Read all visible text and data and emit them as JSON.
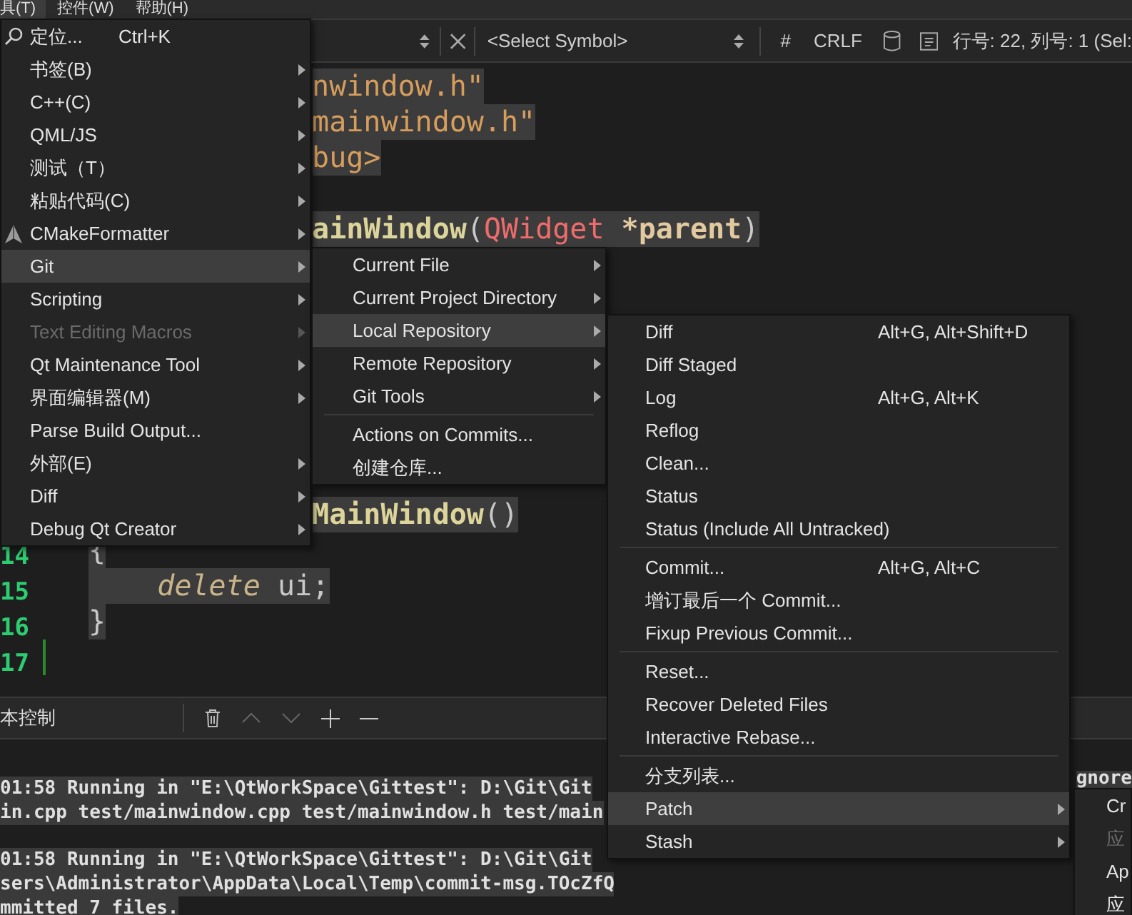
{
  "menubar": [
    {
      "label": "具(T)",
      "selected": true
    },
    {
      "label": "控件(W)",
      "selected": false
    },
    {
      "label": "帮助(H)",
      "selected": false
    }
  ],
  "editor_toolbar": {
    "symbol_placeholder": "<Select Symbol>",
    "indent": "#",
    "line_ending": "CRLF",
    "position": "行号: 22, 列号: 1 (Sel:"
  },
  "code_lines": [
    {
      "covered_by_menu": true,
      "selected": true,
      "segments": [
        {
          "kind": "string",
          "text": "nwindow.h\""
        }
      ]
    },
    {
      "covered_by_menu": true,
      "selected": true,
      "segments": [
        {
          "kind": "string",
          "text": "mainwindow.h\""
        }
      ]
    },
    {
      "covered_by_menu": true,
      "selected": true,
      "segments": [
        {
          "kind": "string",
          "text": "bug>"
        }
      ]
    },
    {
      "blank": true
    },
    {
      "covered_by_menu": true,
      "selected": true,
      "segments": [
        {
          "kind": "function",
          "text": "ainWindow"
        },
        {
          "kind": "plain",
          "text": "("
        },
        {
          "kind": "type",
          "text": "QWidget"
        },
        {
          "kind": "param",
          "text": " *parent"
        },
        {
          "kind": "plain",
          "text": ")"
        }
      ]
    },
    {
      "blank": true
    },
    {
      "blank": true
    },
    {
      "blank": true
    },
    {
      "blank": true
    },
    {
      "blank": true
    },
    {
      "blank": true
    },
    {
      "blank": true
    },
    {
      "covered_by_menu": true,
      "selected": true,
      "segments": [
        {
          "kind": "function",
          "text": "MainWindow"
        },
        {
          "kind": "plain",
          "text": "()"
        }
      ]
    },
    {
      "number": "14",
      "covered_by_menu": false,
      "selected": true,
      "segments": [
        {
          "kind": "plain",
          "text": "{"
        }
      ]
    },
    {
      "number": "15",
      "covered_by_menu": false,
      "selected": true,
      "segments": [
        {
          "kind": "keyword",
          "text": "    delete"
        },
        {
          "kind": "plain",
          "text": " ui;"
        }
      ]
    },
    {
      "number": "16",
      "covered_by_menu": false,
      "selected": true,
      "segments": [
        {
          "kind": "plain",
          "text": "}"
        }
      ]
    },
    {
      "number": "17",
      "blank": true
    }
  ],
  "output_panel": {
    "title": "本控制",
    "entries": [
      {
        "lines": [
          "01:58 Running in \"E:\\QtWorkSpace\\Gittest\": D:\\Git\\Git",
          "in.cpp test/mainwindow.cpp test/mainwindow.h test/main"
        ],
        "tail": "gnore"
      },
      {
        "lines": [
          "01:58 Running in \"E:\\QtWorkSpace\\Gittest\": D:\\Git\\Git",
          "sers\\Administrator\\AppData\\Local\\Temp\\commit-msg.TOcZfQ",
          "mmitted 7 files."
        ]
      }
    ]
  },
  "tools_menu": {
    "items": [
      {
        "kind": "icon_item",
        "label": "定位...",
        "shortcut": "Ctrl+K",
        "submenu": false,
        "selected": false,
        "disabled": false
      },
      {
        "kind": "item",
        "label": "书签(B)",
        "submenu": true,
        "selected": false,
        "disabled": false
      },
      {
        "kind": "item",
        "label": "C++(C)",
        "submenu": true,
        "selected": false,
        "disabled": false
      },
      {
        "kind": "item",
        "label": "QML/JS",
        "submenu": true,
        "selected": false,
        "disabled": false
      },
      {
        "kind": "item",
        "label": "测试（T）",
        "submenu": true,
        "selected": false,
        "disabled": false
      },
      {
        "kind": "item",
        "label": "粘贴代码(C)",
        "submenu": true,
        "selected": false,
        "disabled": false
      },
      {
        "kind": "icon_item",
        "label": "CMakeFormatter",
        "submenu": true,
        "selected": false,
        "disabled": false
      },
      {
        "kind": "item",
        "label": "Git",
        "submenu": true,
        "selected": true,
        "disabled": false
      },
      {
        "kind": "item",
        "label": "Scripting",
        "submenu": true,
        "selected": false,
        "disabled": false
      },
      {
        "kind": "item",
        "label": "Text Editing Macros",
        "submenu": true,
        "selected": false,
        "disabled": true
      },
      {
        "kind": "item",
        "label": "Qt Maintenance Tool",
        "submenu": true,
        "selected": false,
        "disabled": false
      },
      {
        "kind": "item",
        "label": "界面编辑器(M)",
        "submenu": true,
        "selected": false,
        "disabled": false
      },
      {
        "kind": "item",
        "label": "Parse Build Output...",
        "submenu": false,
        "selected": false,
        "disabled": false
      },
      {
        "kind": "item",
        "label": "外部(E)",
        "submenu": true,
        "selected": false,
        "disabled": false
      },
      {
        "kind": "item",
        "label": "Diff",
        "submenu": true,
        "selected": false,
        "disabled": false
      },
      {
        "kind": "item",
        "label": "Debug Qt Creator",
        "submenu": true,
        "selected": false,
        "disabled": false
      }
    ]
  },
  "git_menu": {
    "items": [
      {
        "kind": "item",
        "label": "Current File",
        "submenu": true,
        "selected": false,
        "disabled": false
      },
      {
        "kind": "item",
        "label": "Current Project Directory",
        "submenu": true,
        "selected": false,
        "disabled": false
      },
      {
        "kind": "item",
        "label": "Local Repository",
        "submenu": true,
        "selected": true,
        "disabled": false
      },
      {
        "kind": "item",
        "label": "Remote Repository",
        "submenu": true,
        "selected": false,
        "disabled": false
      },
      {
        "kind": "item",
        "label": "Git Tools",
        "submenu": true,
        "selected": false,
        "disabled": false
      },
      {
        "kind": "separator"
      },
      {
        "kind": "item",
        "label": "Actions on Commits...",
        "submenu": false,
        "selected": false,
        "disabled": false
      },
      {
        "kind": "item",
        "label": "创建仓库...",
        "submenu": false,
        "selected": false,
        "disabled": false
      }
    ]
  },
  "local_repository_menu": {
    "items": [
      {
        "kind": "item",
        "label": "Diff",
        "shortcut": "Alt+G, Alt+Shift+D",
        "submenu": false,
        "selected": false,
        "disabled": false
      },
      {
        "kind": "item",
        "label": "Diff Staged",
        "submenu": false,
        "selected": false,
        "disabled": false
      },
      {
        "kind": "item",
        "label": "Log",
        "shortcut": "Alt+G, Alt+K",
        "submenu": false,
        "selected": false,
        "disabled": false
      },
      {
        "kind": "item",
        "label": "Reflog",
        "submenu": false,
        "selected": false,
        "disabled": false
      },
      {
        "kind": "item",
        "label": "Clean...",
        "submenu": false,
        "selected": false,
        "disabled": false
      },
      {
        "kind": "item",
        "label": "Status",
        "submenu": false,
        "selected": false,
        "disabled": false
      },
      {
        "kind": "item",
        "label": "Status (Include All Untracked)",
        "submenu": false,
        "selected": false,
        "disabled": false
      },
      {
        "kind": "separator"
      },
      {
        "kind": "item",
        "label": "Commit...",
        "shortcut": "Alt+G, Alt+C",
        "submenu": false,
        "selected": false,
        "disabled": false
      },
      {
        "kind": "item",
        "label": "增订最后一个 Commit...",
        "submenu": false,
        "selected": false,
        "disabled": false
      },
      {
        "kind": "item",
        "label": "Fixup Previous Commit...",
        "submenu": false,
        "selected": false,
        "disabled": false
      },
      {
        "kind": "separator"
      },
      {
        "kind": "item",
        "label": "Reset...",
        "submenu": false,
        "selected": false,
        "disabled": false
      },
      {
        "kind": "item",
        "label": "Recover Deleted Files",
        "submenu": false,
        "selected": false,
        "disabled": false
      },
      {
        "kind": "item",
        "label": "Interactive Rebase...",
        "submenu": false,
        "selected": false,
        "disabled": false
      },
      {
        "kind": "separator"
      },
      {
        "kind": "item",
        "label": "分支列表...",
        "submenu": false,
        "selected": false,
        "disabled": false
      },
      {
        "kind": "item",
        "label": "Patch",
        "submenu": true,
        "selected": true,
        "disabled": false
      },
      {
        "kind": "item",
        "label": "Stash",
        "submenu": true,
        "selected": false,
        "disabled": false
      }
    ]
  },
  "patch_menu": {
    "items": [
      {
        "kind": "item",
        "label": "Cr",
        "selected": false,
        "disabled": false
      },
      {
        "kind": "item",
        "label": "应",
        "selected": false,
        "disabled": true
      },
      {
        "kind": "item",
        "label": "Ap",
        "selected": false,
        "disabled": false
      },
      {
        "kind": "item",
        "label": "应",
        "selected": false,
        "disabled": false
      }
    ]
  }
}
